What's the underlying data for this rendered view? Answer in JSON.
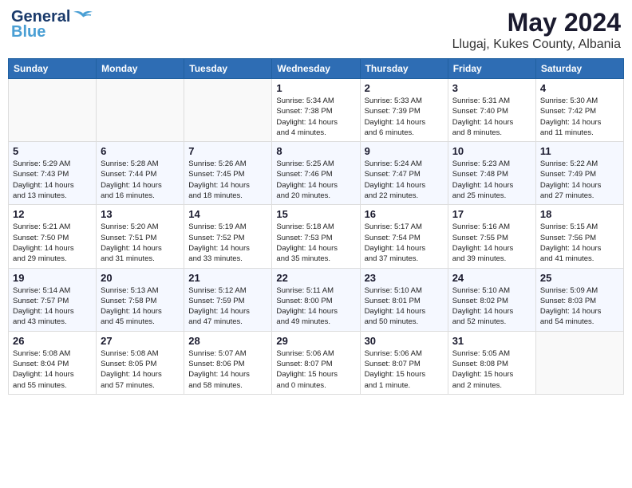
{
  "header": {
    "logo_line1": "General",
    "logo_line2": "Blue",
    "month": "May 2024",
    "location": "Llugaj, Kukes County, Albania"
  },
  "weekdays": [
    "Sunday",
    "Monday",
    "Tuesday",
    "Wednesday",
    "Thursday",
    "Friday",
    "Saturday"
  ],
  "weeks": [
    [
      {
        "day": "",
        "info": ""
      },
      {
        "day": "",
        "info": ""
      },
      {
        "day": "",
        "info": ""
      },
      {
        "day": "1",
        "info": "Sunrise: 5:34 AM\nSunset: 7:38 PM\nDaylight: 14 hours\nand 4 minutes."
      },
      {
        "day": "2",
        "info": "Sunrise: 5:33 AM\nSunset: 7:39 PM\nDaylight: 14 hours\nand 6 minutes."
      },
      {
        "day": "3",
        "info": "Sunrise: 5:31 AM\nSunset: 7:40 PM\nDaylight: 14 hours\nand 8 minutes."
      },
      {
        "day": "4",
        "info": "Sunrise: 5:30 AM\nSunset: 7:42 PM\nDaylight: 14 hours\nand 11 minutes."
      }
    ],
    [
      {
        "day": "5",
        "info": "Sunrise: 5:29 AM\nSunset: 7:43 PM\nDaylight: 14 hours\nand 13 minutes."
      },
      {
        "day": "6",
        "info": "Sunrise: 5:28 AM\nSunset: 7:44 PM\nDaylight: 14 hours\nand 16 minutes."
      },
      {
        "day": "7",
        "info": "Sunrise: 5:26 AM\nSunset: 7:45 PM\nDaylight: 14 hours\nand 18 minutes."
      },
      {
        "day": "8",
        "info": "Sunrise: 5:25 AM\nSunset: 7:46 PM\nDaylight: 14 hours\nand 20 minutes."
      },
      {
        "day": "9",
        "info": "Sunrise: 5:24 AM\nSunset: 7:47 PM\nDaylight: 14 hours\nand 22 minutes."
      },
      {
        "day": "10",
        "info": "Sunrise: 5:23 AM\nSunset: 7:48 PM\nDaylight: 14 hours\nand 25 minutes."
      },
      {
        "day": "11",
        "info": "Sunrise: 5:22 AM\nSunset: 7:49 PM\nDaylight: 14 hours\nand 27 minutes."
      }
    ],
    [
      {
        "day": "12",
        "info": "Sunrise: 5:21 AM\nSunset: 7:50 PM\nDaylight: 14 hours\nand 29 minutes."
      },
      {
        "day": "13",
        "info": "Sunrise: 5:20 AM\nSunset: 7:51 PM\nDaylight: 14 hours\nand 31 minutes."
      },
      {
        "day": "14",
        "info": "Sunrise: 5:19 AM\nSunset: 7:52 PM\nDaylight: 14 hours\nand 33 minutes."
      },
      {
        "day": "15",
        "info": "Sunrise: 5:18 AM\nSunset: 7:53 PM\nDaylight: 14 hours\nand 35 minutes."
      },
      {
        "day": "16",
        "info": "Sunrise: 5:17 AM\nSunset: 7:54 PM\nDaylight: 14 hours\nand 37 minutes."
      },
      {
        "day": "17",
        "info": "Sunrise: 5:16 AM\nSunset: 7:55 PM\nDaylight: 14 hours\nand 39 minutes."
      },
      {
        "day": "18",
        "info": "Sunrise: 5:15 AM\nSunset: 7:56 PM\nDaylight: 14 hours\nand 41 minutes."
      }
    ],
    [
      {
        "day": "19",
        "info": "Sunrise: 5:14 AM\nSunset: 7:57 PM\nDaylight: 14 hours\nand 43 minutes."
      },
      {
        "day": "20",
        "info": "Sunrise: 5:13 AM\nSunset: 7:58 PM\nDaylight: 14 hours\nand 45 minutes."
      },
      {
        "day": "21",
        "info": "Sunrise: 5:12 AM\nSunset: 7:59 PM\nDaylight: 14 hours\nand 47 minutes."
      },
      {
        "day": "22",
        "info": "Sunrise: 5:11 AM\nSunset: 8:00 PM\nDaylight: 14 hours\nand 49 minutes."
      },
      {
        "day": "23",
        "info": "Sunrise: 5:10 AM\nSunset: 8:01 PM\nDaylight: 14 hours\nand 50 minutes."
      },
      {
        "day": "24",
        "info": "Sunrise: 5:10 AM\nSunset: 8:02 PM\nDaylight: 14 hours\nand 52 minutes."
      },
      {
        "day": "25",
        "info": "Sunrise: 5:09 AM\nSunset: 8:03 PM\nDaylight: 14 hours\nand 54 minutes."
      }
    ],
    [
      {
        "day": "26",
        "info": "Sunrise: 5:08 AM\nSunset: 8:04 PM\nDaylight: 14 hours\nand 55 minutes."
      },
      {
        "day": "27",
        "info": "Sunrise: 5:08 AM\nSunset: 8:05 PM\nDaylight: 14 hours\nand 57 minutes."
      },
      {
        "day": "28",
        "info": "Sunrise: 5:07 AM\nSunset: 8:06 PM\nDaylight: 14 hours\nand 58 minutes."
      },
      {
        "day": "29",
        "info": "Sunrise: 5:06 AM\nSunset: 8:07 PM\nDaylight: 15 hours\nand 0 minutes."
      },
      {
        "day": "30",
        "info": "Sunrise: 5:06 AM\nSunset: 8:07 PM\nDaylight: 15 hours\nand 1 minute."
      },
      {
        "day": "31",
        "info": "Sunrise: 5:05 AM\nSunset: 8:08 PM\nDaylight: 15 hours\nand 2 minutes."
      },
      {
        "day": "",
        "info": ""
      }
    ]
  ]
}
